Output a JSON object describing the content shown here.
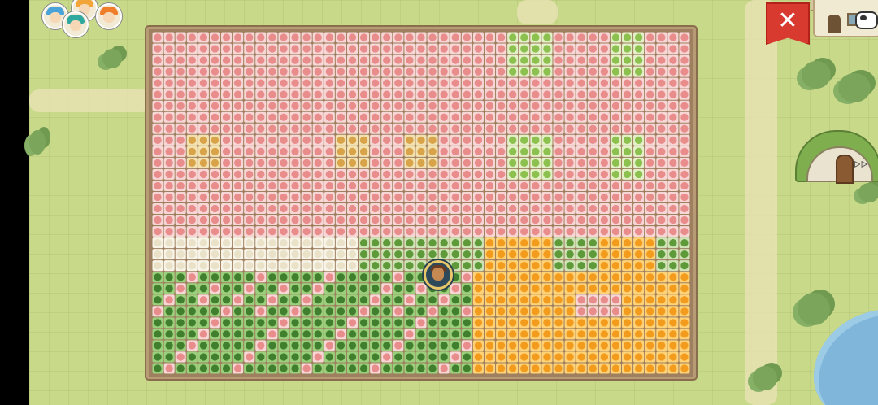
{
  "header": {
    "close_button": {
      "label": "✕",
      "icon": "close-icon"
    }
  },
  "party": {
    "members": [
      {
        "name": "avatar-1",
        "hair_color": "#4aa3d8"
      },
      {
        "name": "avatar-2",
        "hair_color": "#f2a53a"
      },
      {
        "name": "avatar-3",
        "hair_color": "#2fa8a0"
      },
      {
        "name": "avatar-4",
        "hair_color": "#f07d2a"
      }
    ]
  },
  "buildings": {
    "shop": {
      "icon": "shop-building-icon"
    },
    "cave": {
      "icon": "cave-house-icon",
      "sign": "ᐅᐅ"
    }
  },
  "farm": {
    "columns": 47,
    "rows": 30,
    "crops": {
      "tomato": {
        "color": "#e98c8c",
        "ring": "#f7d6d6"
      },
      "carrot": {
        "color": "#d67a2e",
        "ring": "#f4d49a"
      },
      "wheat": {
        "color": "#d9a34a",
        "ring": "#f3e1b0"
      },
      "lettuce": {
        "color": "#8cc04f",
        "ring": "#e4f0c8"
      },
      "cotton": {
        "color": "#e9e2c8",
        "ring": "#f8f4e8"
      },
      "pea": {
        "color": "#5e9a3a",
        "ring": "#cfe3b6"
      },
      "pumpkin": {
        "color": "#f29b1d",
        "ring": "#ffd277"
      },
      "cucumber": {
        "color": "#3f7f2e",
        "ring": "#9ccf7c"
      }
    }
  },
  "colors": {
    "field_bg": "#9e8060",
    "grass": "#c9d98a",
    "close_red": "#d83a2f"
  }
}
